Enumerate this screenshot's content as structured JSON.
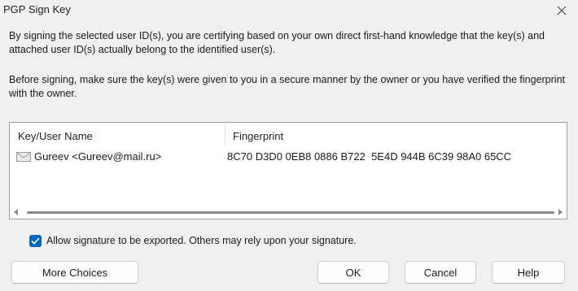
{
  "window": {
    "title": "PGP Sign Key"
  },
  "info": {
    "paragraph1": "By signing the selected user ID(s), you are certifying based on your own direct first-hand knowledge that the key(s) and attached user ID(s) actually belong to the identified user(s).",
    "paragraph2": "Before signing, make sure the key(s) were given to you in a secure manner by the owner or you have verified the fingerprint with the owner."
  },
  "key_list": {
    "columns": [
      "Key/User Name",
      "Fingerprint"
    ],
    "rows": [
      {
        "icon": "envelope-icon",
        "name": "Gureev <Gureev@mail.ru>",
        "fingerprint": "8C70 D3D0 0EB8 0886 B722  5E4D 944B 6C39 98A0 65CC"
      }
    ]
  },
  "export_option": {
    "checked": true,
    "label": "Allow signature to be exported.  Others may rely upon your signature."
  },
  "buttons": {
    "more_choices": "More Choices",
    "ok": "OK",
    "cancel": "Cancel",
    "help": "Help"
  },
  "colors": {
    "accent": "#0067c0",
    "background": "#f0f0f0"
  }
}
